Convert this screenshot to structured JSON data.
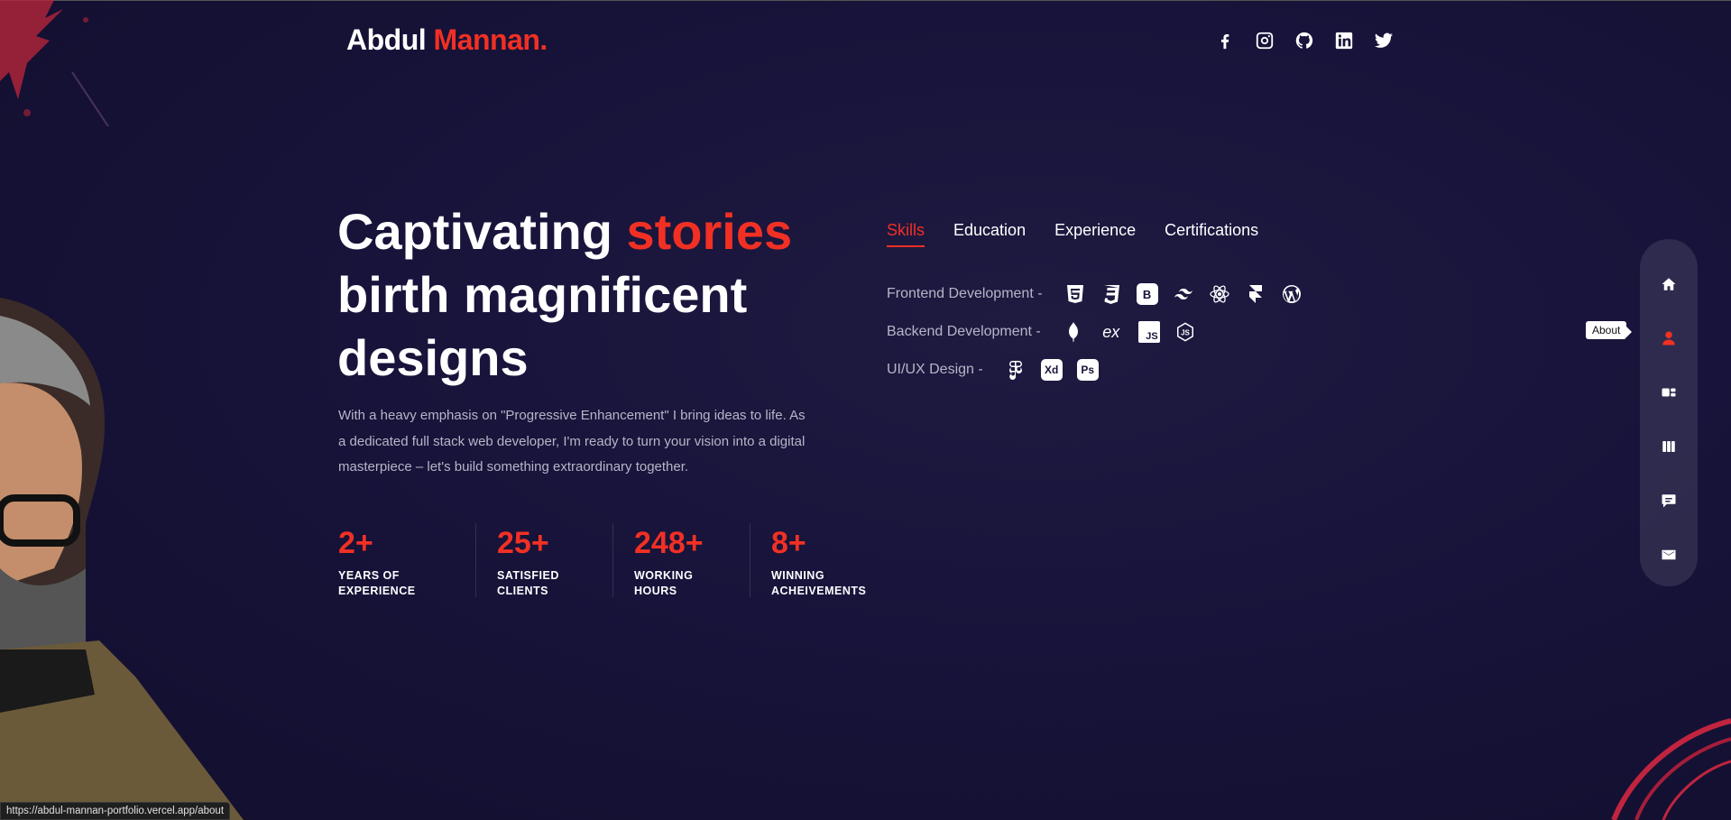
{
  "logo": {
    "name": "Abdul",
    "accent": "Mannan."
  },
  "socials": [
    {
      "icon": "facebook-icon"
    },
    {
      "icon": "instagram-icon"
    },
    {
      "icon": "github-icon"
    },
    {
      "icon": "linkedin-icon"
    },
    {
      "icon": "twitter-icon"
    }
  ],
  "hero": {
    "title_line1": "Captivating",
    "title_accent": "stories",
    "title_line2": "birth magnificent",
    "title_line3": "designs",
    "description": "With a heavy emphasis on \"Progressive Enhancement\" I bring ideas to life. As a dedicated full stack web developer, I'm ready to turn your vision into a digital masterpiece – let's build something extraordinary together."
  },
  "stats": [
    {
      "value": "2+",
      "label": "YEARS OF EXPERIENCE"
    },
    {
      "value": "25+",
      "label": "SATISFIED CLIENTS"
    },
    {
      "value": "248+",
      "label": "WORKING HOURS"
    },
    {
      "value": "8+",
      "label": "WINNING ACHEIVEMENTS"
    }
  ],
  "tabs": [
    {
      "label": "Skills",
      "active": true
    },
    {
      "label": "Education"
    },
    {
      "label": "Experience"
    },
    {
      "label": "Certifications"
    }
  ],
  "skills": [
    {
      "title": "Frontend Development -",
      "icons": [
        "html5-icon",
        "css3-icon",
        "bootstrap-icon",
        "tailwind-icon",
        "react-icon",
        "framer-icon",
        "wordpress-icon"
      ]
    },
    {
      "title": "Backend Development -",
      "icons": [
        "mongodb-icon",
        "express-icon",
        "javascript-icon",
        "nodejs-icon"
      ]
    },
    {
      "title": "UI/UX Design -",
      "icons": [
        "figma-icon",
        "adobe-xd-icon",
        "photoshop-icon"
      ]
    }
  ],
  "badges": {
    "bootstrap": "B",
    "js": "JS",
    "xd": "Xd",
    "ps": "Ps",
    "express": "ex"
  },
  "nav": {
    "tooltip": "About",
    "items": [
      "home-icon",
      "user-icon",
      "work-icon",
      "portfolio-icon",
      "testimonial-icon",
      "mail-icon"
    ]
  },
  "status_url": "https://abdul-mannan-portfolio.vercel.app/about",
  "colors": {
    "accent": "#f13024",
    "background": "#17133a"
  }
}
